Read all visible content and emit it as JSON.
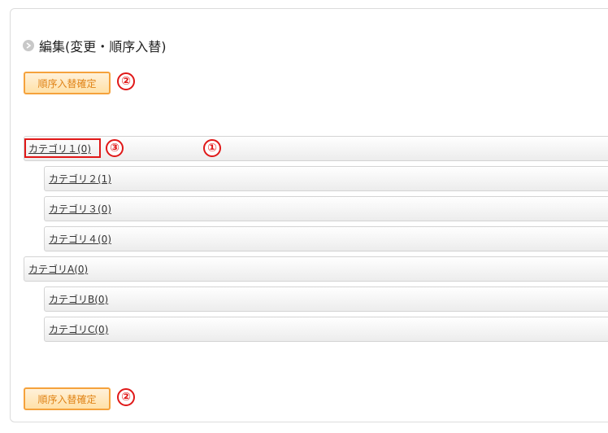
{
  "section": {
    "title": "編集(変更・順序入替)"
  },
  "buttons": {
    "confirm_top": "順序入替確定",
    "confirm_bottom": "順序入替確定"
  },
  "markers": {
    "top_button": "②",
    "first_row": "①",
    "first_link": "③",
    "bottom_button": "②"
  },
  "categories": [
    {
      "label": "カテゴリ１(0)",
      "level": 0
    },
    {
      "label": "カテゴリ２(1)",
      "level": 1
    },
    {
      "label": "カテゴリ３(0)",
      "level": 1
    },
    {
      "label": "カテゴリ４(0)",
      "level": 1
    },
    {
      "label": "カテゴリA(0)",
      "level": 0
    },
    {
      "label": "カテゴリB(0)",
      "level": 1
    },
    {
      "label": "カテゴリC(0)",
      "level": 1
    }
  ],
  "colors": {
    "button_border": "#f5a23c",
    "button_text": "#e08316",
    "marker": "#e01818"
  }
}
